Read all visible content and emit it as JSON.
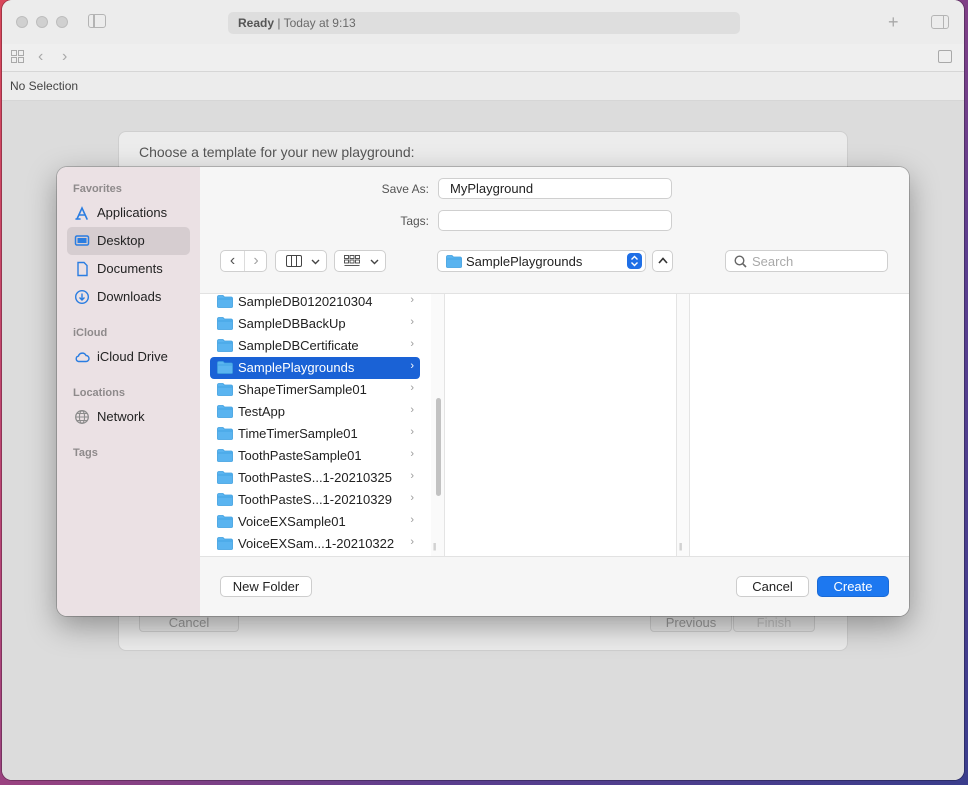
{
  "window": {
    "status_state": "Ready",
    "status_time": "Today at 9:13",
    "no_selection": "No Selection"
  },
  "template_sheet": {
    "title": "Choose a template for your new playground:",
    "cancel": "Cancel",
    "previous": "Previous",
    "finish": "Finish"
  },
  "sidebar": {
    "favorites_header": "Favorites",
    "favorites": [
      {
        "label": "Applications",
        "icon": "applications-icon"
      },
      {
        "label": "Desktop",
        "icon": "desktop-icon",
        "selected": true
      },
      {
        "label": "Documents",
        "icon": "document-icon"
      },
      {
        "label": "Downloads",
        "icon": "download-icon"
      }
    ],
    "icloud_header": "iCloud",
    "icloud": [
      {
        "label": "iCloud Drive",
        "icon": "cloud-icon"
      }
    ],
    "locations_header": "Locations",
    "locations": [
      {
        "label": "Network",
        "icon": "globe-icon"
      }
    ],
    "tags_header": "Tags"
  },
  "form": {
    "save_as_label": "Save As:",
    "save_as_value": "MyPlayground",
    "tags_label": "Tags:",
    "tags_value": ""
  },
  "nav": {
    "current_folder": "SamplePlaygrounds",
    "search_placeholder": "Search"
  },
  "files": [
    {
      "name": "SampleDB0120210304"
    },
    {
      "name": "SampleDBBackUp"
    },
    {
      "name": "SampleDBCertificate"
    },
    {
      "name": "SamplePlaygrounds",
      "selected": true
    },
    {
      "name": "ShapeTimerSample01"
    },
    {
      "name": "TestApp"
    },
    {
      "name": "TimeTimerSample01"
    },
    {
      "name": "ToothPasteSample01"
    },
    {
      "name": "ToothPasteS...1-20210325"
    },
    {
      "name": "ToothPasteS...1-20210329"
    },
    {
      "name": "VoiceEXSample01"
    },
    {
      "name": "VoiceEXSam...1-20210322"
    }
  ],
  "footer": {
    "new_folder": "New Folder",
    "cancel": "Cancel",
    "create": "Create"
  },
  "colors": {
    "accent": "#1d78f0",
    "selection": "#1a62d6",
    "folder": "#5ab4f0"
  }
}
